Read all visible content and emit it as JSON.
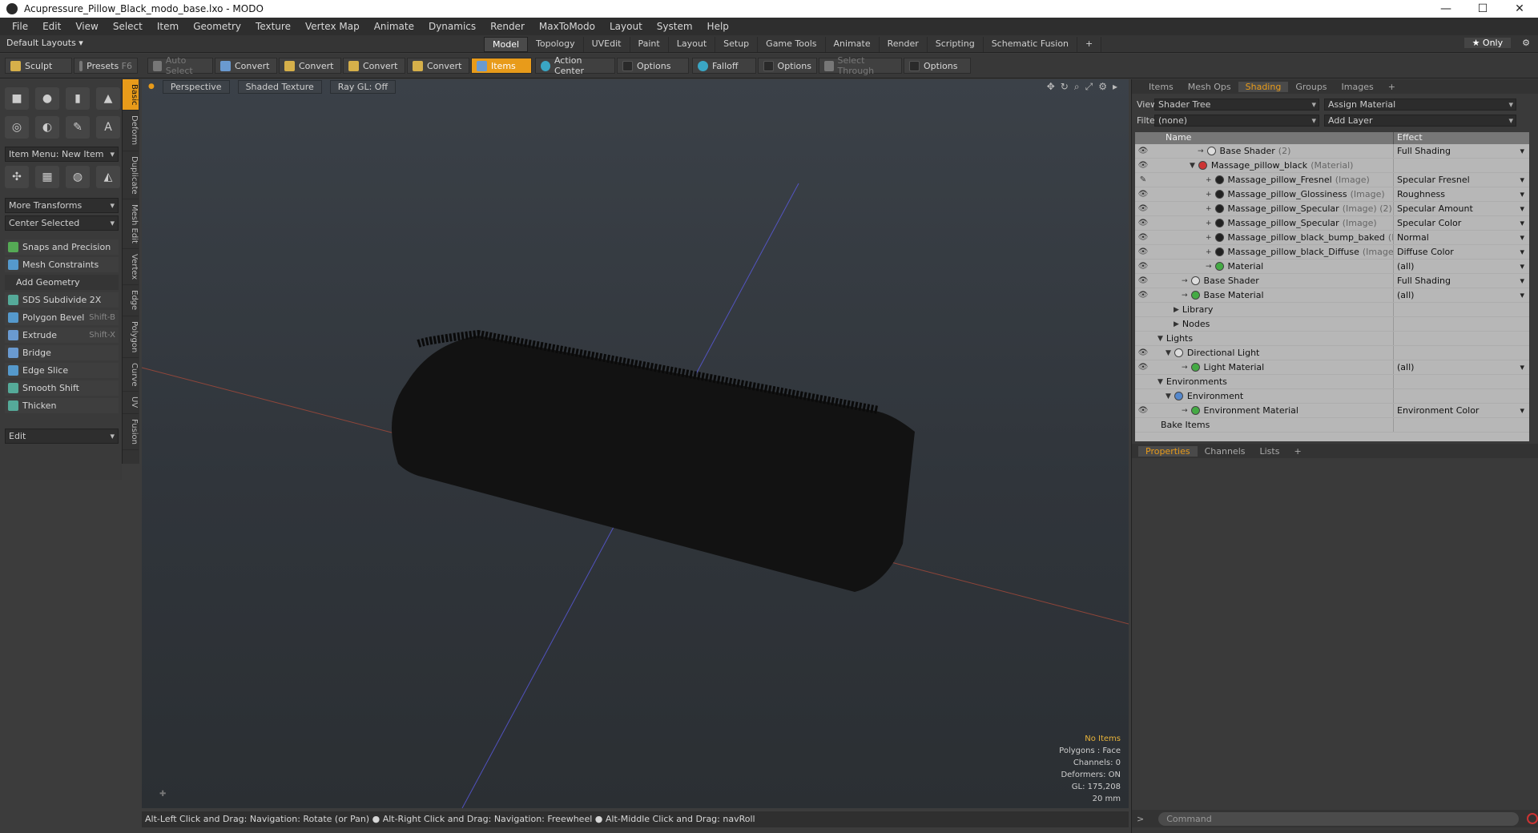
{
  "window": {
    "title": "Acupressure_Pillow_Black_modo_base.lxo - MODO",
    "controls": [
      "—",
      "☐",
      "✕"
    ]
  },
  "menu": [
    "File",
    "Edit",
    "View",
    "Select",
    "Item",
    "Geometry",
    "Texture",
    "Vertex Map",
    "Animate",
    "Dynamics",
    "Render",
    "MaxToModo",
    "Layout",
    "System",
    "Help"
  ],
  "layouts": {
    "selector": "Default Layouts ▾",
    "tabs": [
      "Model",
      "Topology",
      "UVEdit",
      "Paint",
      "Layout",
      "Setup",
      "Game Tools",
      "Animate",
      "Render",
      "Scripting",
      "Schematic Fusion",
      "+"
    ],
    "active": "Model",
    "only": "★ Only"
  },
  "toolbar": {
    "sculpt": "Sculpt",
    "presets": "Presets",
    "presets_key": "F6",
    "auto_select": "Auto Select",
    "convert": "Convert",
    "items": "Items",
    "action_center": "Action Center",
    "options": "Options",
    "falloff": "Falloff",
    "select_through": "Select Through"
  },
  "left": {
    "item_menu": "Item Menu: New Item",
    "more_transforms": "More Transforms",
    "center_selected": "Center Selected",
    "snaps": "Snaps and Precision",
    "mesh_constraints": "Mesh Constraints",
    "add_geometry": "Add Geometry",
    "tools": [
      {
        "label": "SDS Subdivide 2X",
        "key": ""
      },
      {
        "label": "Polygon Bevel",
        "key": "Shift-B"
      },
      {
        "label": "Extrude",
        "key": "Shift-X"
      },
      {
        "label": "Bridge",
        "key": ""
      },
      {
        "label": "Edge Slice",
        "key": ""
      },
      {
        "label": "Smooth Shift",
        "key": ""
      },
      {
        "label": "Thicken",
        "key": ""
      }
    ],
    "edit": "Edit",
    "sidetabs": [
      "Basic",
      "Deform",
      "Duplicate",
      "Mesh Edit",
      "Vertex",
      "Edge",
      "Polygon",
      "Curve",
      "UV",
      "Fusion"
    ]
  },
  "viewport": {
    "perspective": "Perspective",
    "shading": "Shaded Texture",
    "raygl": "Ray GL: Off",
    "info": {
      "no_items": "No Items",
      "polygons": "Polygons : Face",
      "channels": "Channels: 0",
      "deformers": "Deformers: ON",
      "gl": "GL: 175,208",
      "scale": "20 mm"
    }
  },
  "status": "Alt-Left Click and Drag: Navigation: Rotate (or Pan) ● Alt-Right Click and Drag: Navigation: Freewheel ● Alt-Middle Click and Drag: navRoll",
  "right": {
    "tabs": [
      "Items",
      "Mesh Ops",
      "Shading",
      "Groups",
      "Images",
      "+"
    ],
    "active": "Shading",
    "view_label": "View",
    "view": "Shader Tree",
    "assign": "Assign Material",
    "filter_label": "Filter",
    "filter": "(none)",
    "add_layer": "Add Layer",
    "col_name": "Name",
    "col_effect": "Effect",
    "rows": [
      {
        "name": "Base Shader",
        "type": "(2)",
        "effect": "Full Shading",
        "indent": 5,
        "dot": "#ddd",
        "eye": "👁",
        "exp": "→"
      },
      {
        "name": "Massage_pillow_black",
        "type": "(Material)",
        "effect": "",
        "indent": 4,
        "dot": "#c33",
        "eye": "👁",
        "exp": "▼"
      },
      {
        "name": "Massage_pillow_Fresnel",
        "type": "(Image)",
        "effect": "Specular Fresnel",
        "indent": 6,
        "dot": "#222",
        "eye": "✎",
        "exp": "+"
      },
      {
        "name": "Massage_pillow_Glossiness",
        "type": "(Image)",
        "effect": "Roughness",
        "indent": 6,
        "dot": "#222",
        "eye": "👁",
        "exp": "+"
      },
      {
        "name": "Massage_pillow_Specular",
        "type": "(Image) (2)",
        "effect": "Specular Amount",
        "indent": 6,
        "dot": "#222",
        "eye": "👁",
        "exp": "+"
      },
      {
        "name": "Massage_pillow_Specular",
        "type": "(Image)",
        "effect": "Specular Color",
        "indent": 6,
        "dot": "#222",
        "eye": "👁",
        "exp": "+"
      },
      {
        "name": "Massage_pillow_black_bump_baked",
        "type": "(Image)",
        "effect": "Normal",
        "indent": 6,
        "dot": "#222",
        "eye": "👁",
        "exp": "+"
      },
      {
        "name": "Massage_pillow_black_Diffuse",
        "type": "(Image)",
        "effect": "Diffuse Color",
        "indent": 6,
        "dot": "#222",
        "eye": "👁",
        "exp": "+"
      },
      {
        "name": "Material",
        "type": "",
        "effect": "(all)",
        "indent": 6,
        "dot": "#4a4",
        "eye": "👁",
        "exp": "→"
      },
      {
        "name": "Base Shader",
        "type": "",
        "effect": "Full Shading",
        "indent": 3,
        "dot": "#ddd",
        "eye": "👁",
        "exp": "→"
      },
      {
        "name": "Base Material",
        "type": "",
        "effect": "(all)",
        "indent": 3,
        "dot": "#4a4",
        "eye": "👁",
        "exp": "→"
      },
      {
        "name": "Library",
        "type": "",
        "effect": "",
        "indent": 2,
        "dot": "",
        "eye": "",
        "exp": "▶"
      },
      {
        "name": "Nodes",
        "type": "",
        "effect": "",
        "indent": 2,
        "dot": "",
        "eye": "",
        "exp": "▶"
      },
      {
        "name": "Lights",
        "type": "",
        "effect": "",
        "indent": 0,
        "dot": "",
        "eye": "",
        "exp": "▼"
      },
      {
        "name": "Directional Light",
        "type": "",
        "effect": "",
        "indent": 1,
        "dot": "#ddd",
        "eye": "👁",
        "exp": "▼"
      },
      {
        "name": "Light Material",
        "type": "",
        "effect": "(all)",
        "indent": 3,
        "dot": "#4a4",
        "eye": "👁",
        "exp": "→"
      },
      {
        "name": "Environments",
        "type": "",
        "effect": "",
        "indent": 0,
        "dot": "",
        "eye": "",
        "exp": "▼"
      },
      {
        "name": "Environment",
        "type": "",
        "effect": "",
        "indent": 1,
        "dot": "#58c",
        "eye": "",
        "exp": "▼"
      },
      {
        "name": "Environment Material",
        "type": "",
        "effect": "Environment Color",
        "indent": 3,
        "dot": "#4a4",
        "eye": "👁",
        "exp": "→"
      },
      {
        "name": "Bake Items",
        "type": "",
        "effect": "",
        "indent": 0,
        "dot": "",
        "eye": "",
        "exp": ""
      }
    ],
    "prop_tabs": [
      "Properties",
      "Channels",
      "Lists",
      "+"
    ],
    "prop_active": "Properties",
    "command_placeholder": "Command"
  }
}
